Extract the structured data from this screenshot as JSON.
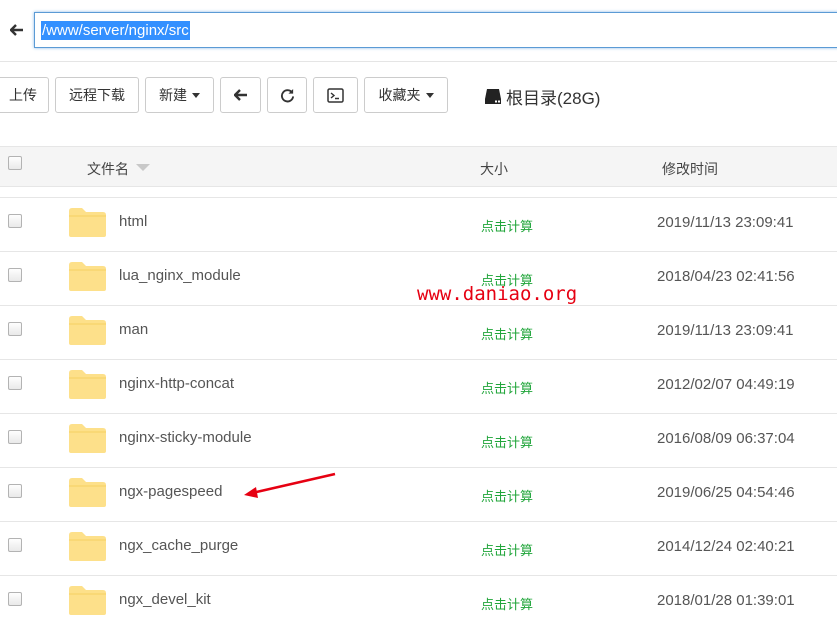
{
  "pathbar": {
    "path": "/www/server/nginx/src",
    "back_icon": "arrow-left-icon"
  },
  "toolbar": {
    "upload": "上传",
    "remote_download": "远程下载",
    "new": "新建",
    "back_icon": "arrow-left-icon",
    "refresh_icon": "refresh-icon",
    "terminal_icon": "terminal-icon",
    "favorites": "收藏夹",
    "disk_icon": "hard-drive-icon",
    "disk_label": "根目录(28G)"
  },
  "table": {
    "headers": {
      "name": "文件名",
      "size": "大小",
      "modified": "修改时间"
    },
    "rows": [
      {
        "name": "html",
        "size": "点击计算",
        "modified": "2019/11/13 23:09:41"
      },
      {
        "name": "lua_nginx_module",
        "size": "点击计算",
        "modified": "2018/04/23 02:41:56"
      },
      {
        "name": "man",
        "size": "点击计算",
        "modified": "2019/11/13 23:09:41"
      },
      {
        "name": "nginx-http-concat",
        "size": "点击计算",
        "modified": "2012/02/07 04:49:19"
      },
      {
        "name": "nginx-sticky-module",
        "size": "点击计算",
        "modified": "2016/08/09 06:37:04"
      },
      {
        "name": "ngx-pagespeed",
        "size": "点击计算",
        "modified": "2019/06/25 04:54:46"
      },
      {
        "name": "ngx_cache_purge",
        "size": "点击计算",
        "modified": "2014/12/24 02:40:21"
      },
      {
        "name": "ngx_devel_kit",
        "size": "点击计算",
        "modified": "2018/01/28 01:39:01"
      }
    ]
  },
  "watermark": "www.daniao.org",
  "colors": {
    "accent_green": "#20a53a",
    "folder": "#fde08a",
    "selection": "#3390ff",
    "annotation_red": "#e60012"
  }
}
